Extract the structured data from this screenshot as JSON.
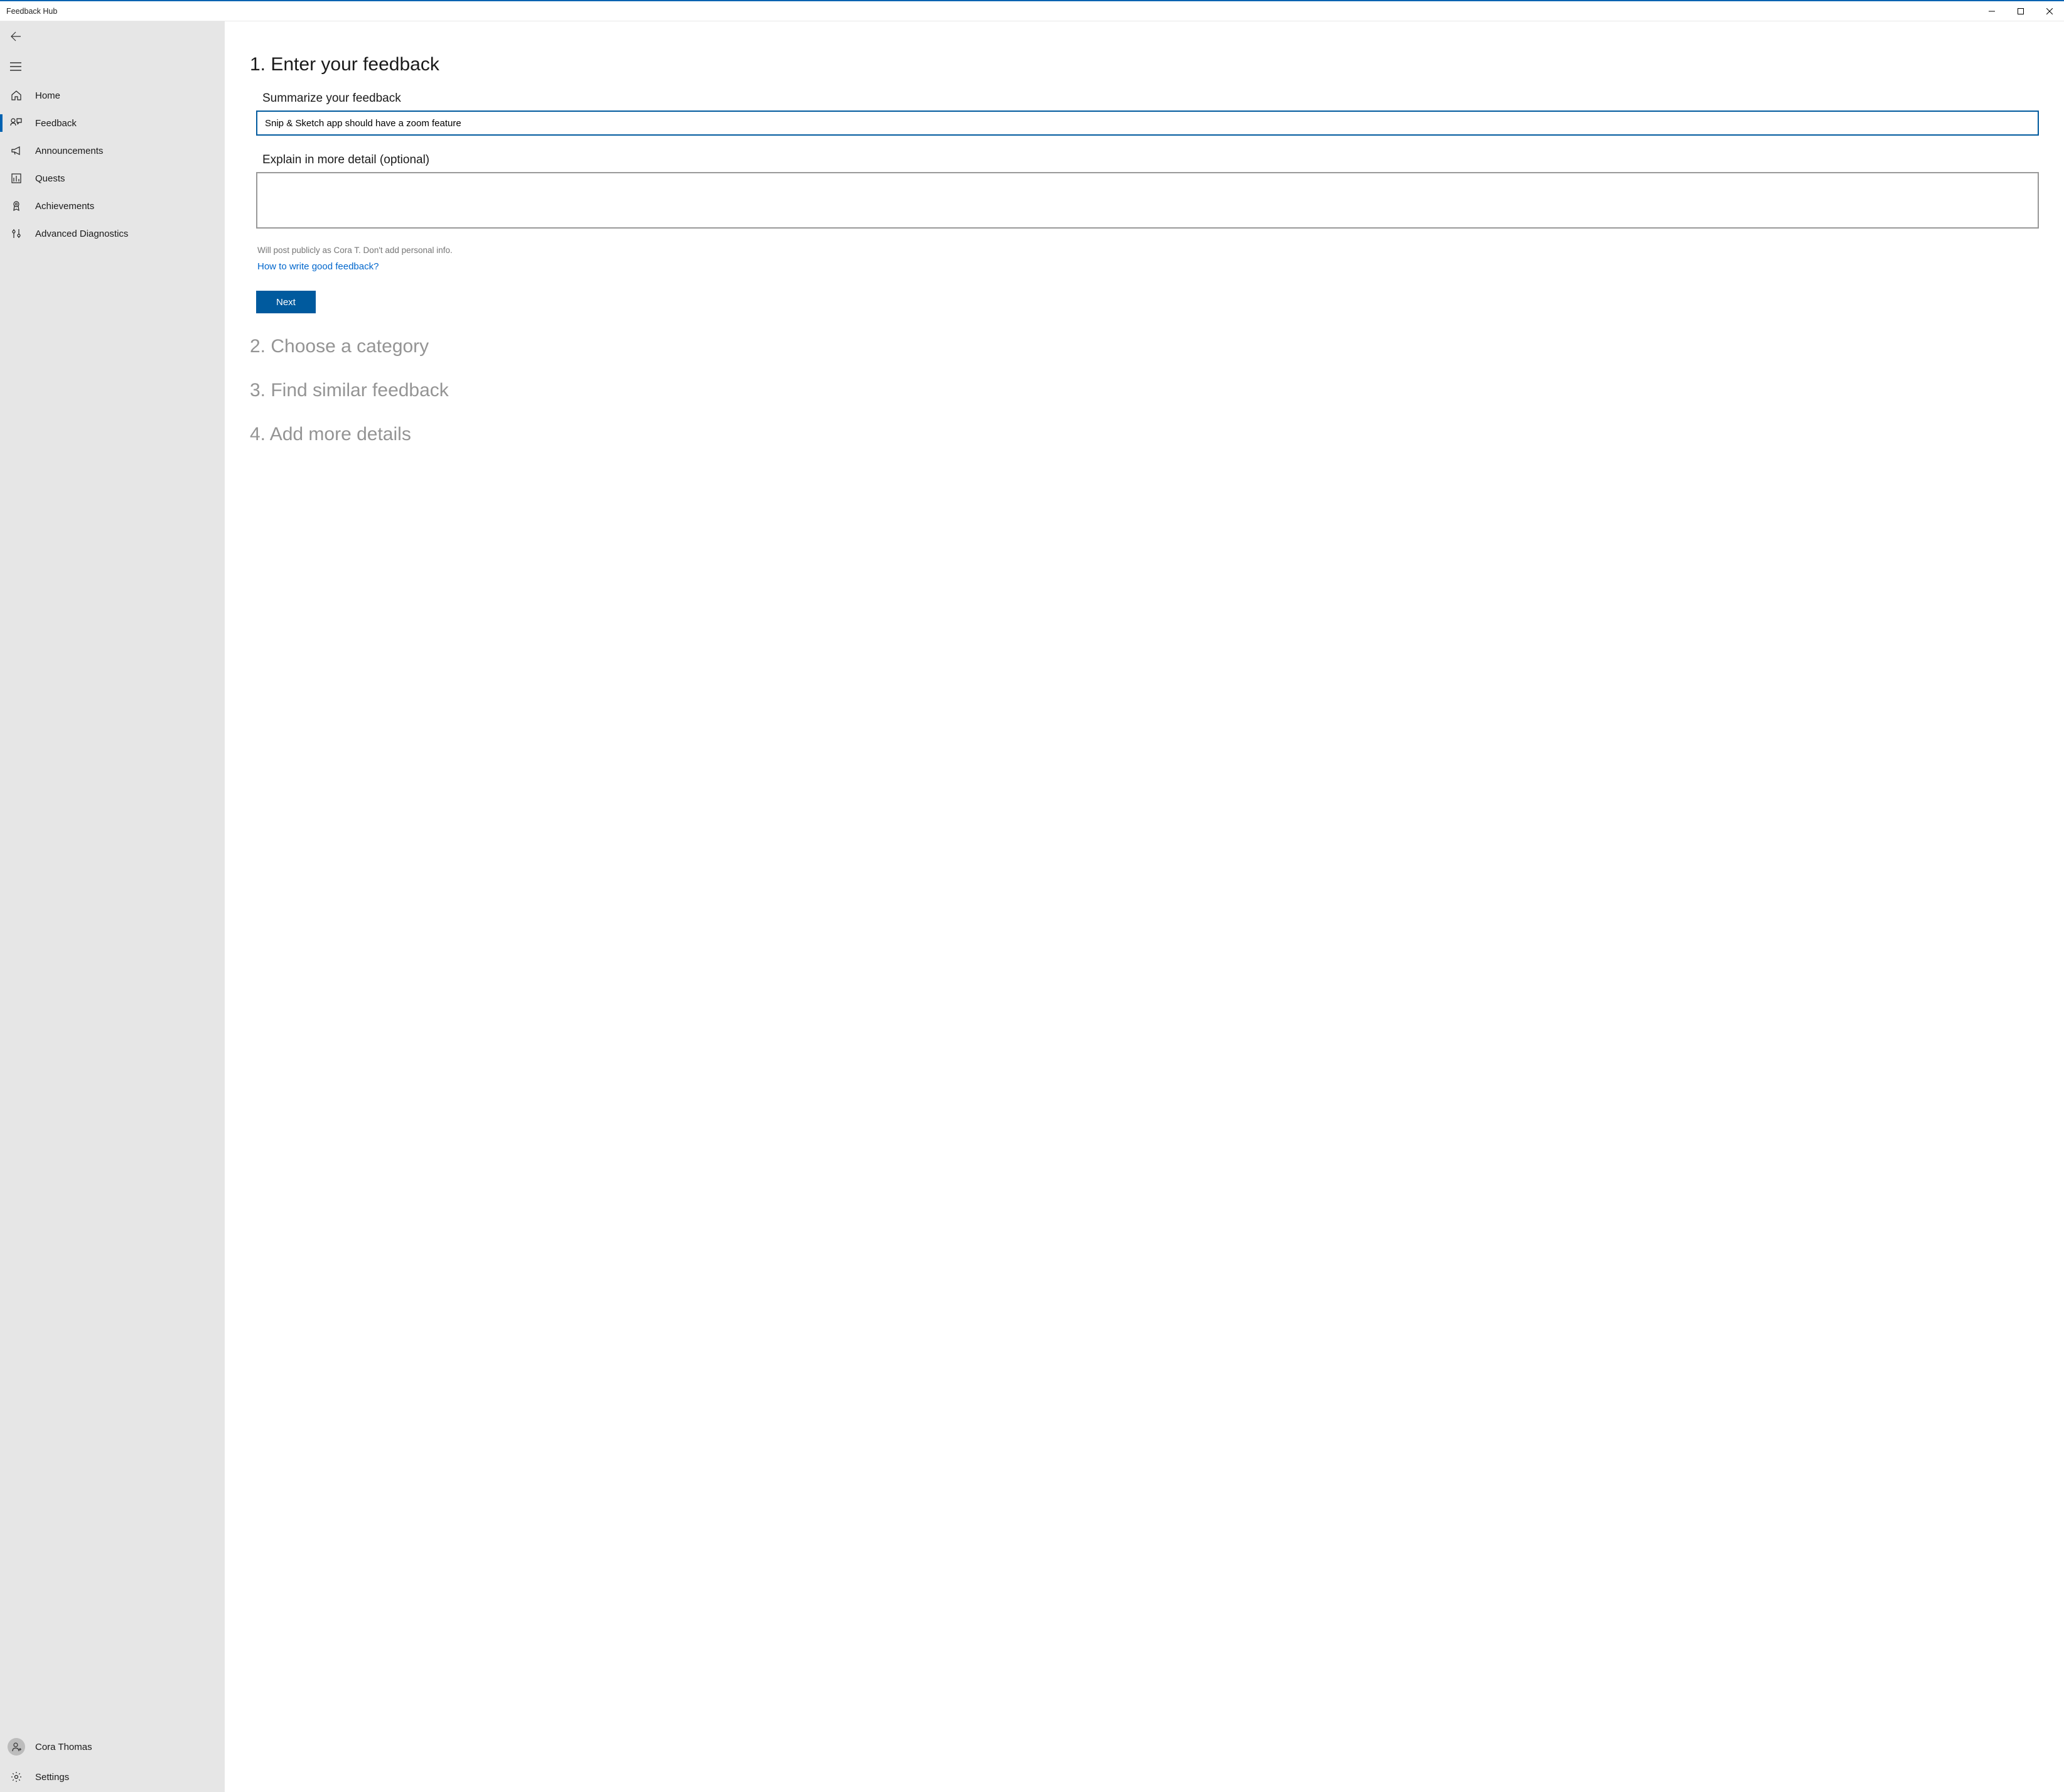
{
  "window": {
    "title": "Feedback Hub"
  },
  "sidebar": {
    "items": [
      {
        "label": "Home",
        "icon": "home-icon"
      },
      {
        "label": "Feedback",
        "icon": "feedback-icon",
        "active": true
      },
      {
        "label": "Announcements",
        "icon": "announcements-icon"
      },
      {
        "label": "Quests",
        "icon": "quests-icon"
      },
      {
        "label": "Achievements",
        "icon": "achievements-icon"
      },
      {
        "label": "Advanced Diagnostics",
        "icon": "diagnostics-icon"
      }
    ],
    "user": {
      "name": "Cora Thomas"
    },
    "settings_label": "Settings"
  },
  "main": {
    "step1": {
      "heading": "1. Enter your feedback",
      "summary_label": "Summarize your feedback",
      "summary_value": "Snip & Sketch app should have a zoom feature",
      "detail_label": "Explain in more detail (optional)",
      "detail_value": "",
      "helper_text": "Will post publicly as Cora T. Don't add personal info.",
      "help_link": "How to write good feedback?",
      "next_button": "Next"
    },
    "step2": {
      "heading": "2. Choose a category"
    },
    "step3": {
      "heading": "3. Find similar feedback"
    },
    "step4": {
      "heading": "4. Add more details"
    }
  }
}
